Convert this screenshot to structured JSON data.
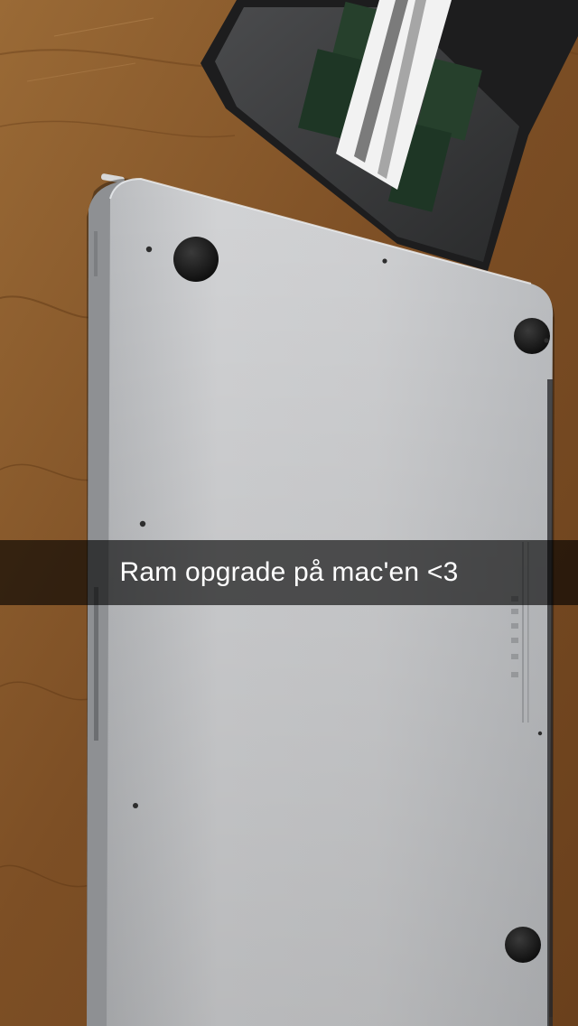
{
  "snap": {
    "caption": "Ram opgrade på mac'en <3"
  },
  "photo": {
    "subject": "laptop-bottom-case",
    "colors": {
      "wood": "#8a5a2c",
      "wood_dark": "#5e3a17",
      "aluminum": "#c9cacc",
      "aluminum_shadow": "#9fa1a4",
      "rubber_foot": "#151515",
      "caption_overlay": "#000000"
    }
  }
}
